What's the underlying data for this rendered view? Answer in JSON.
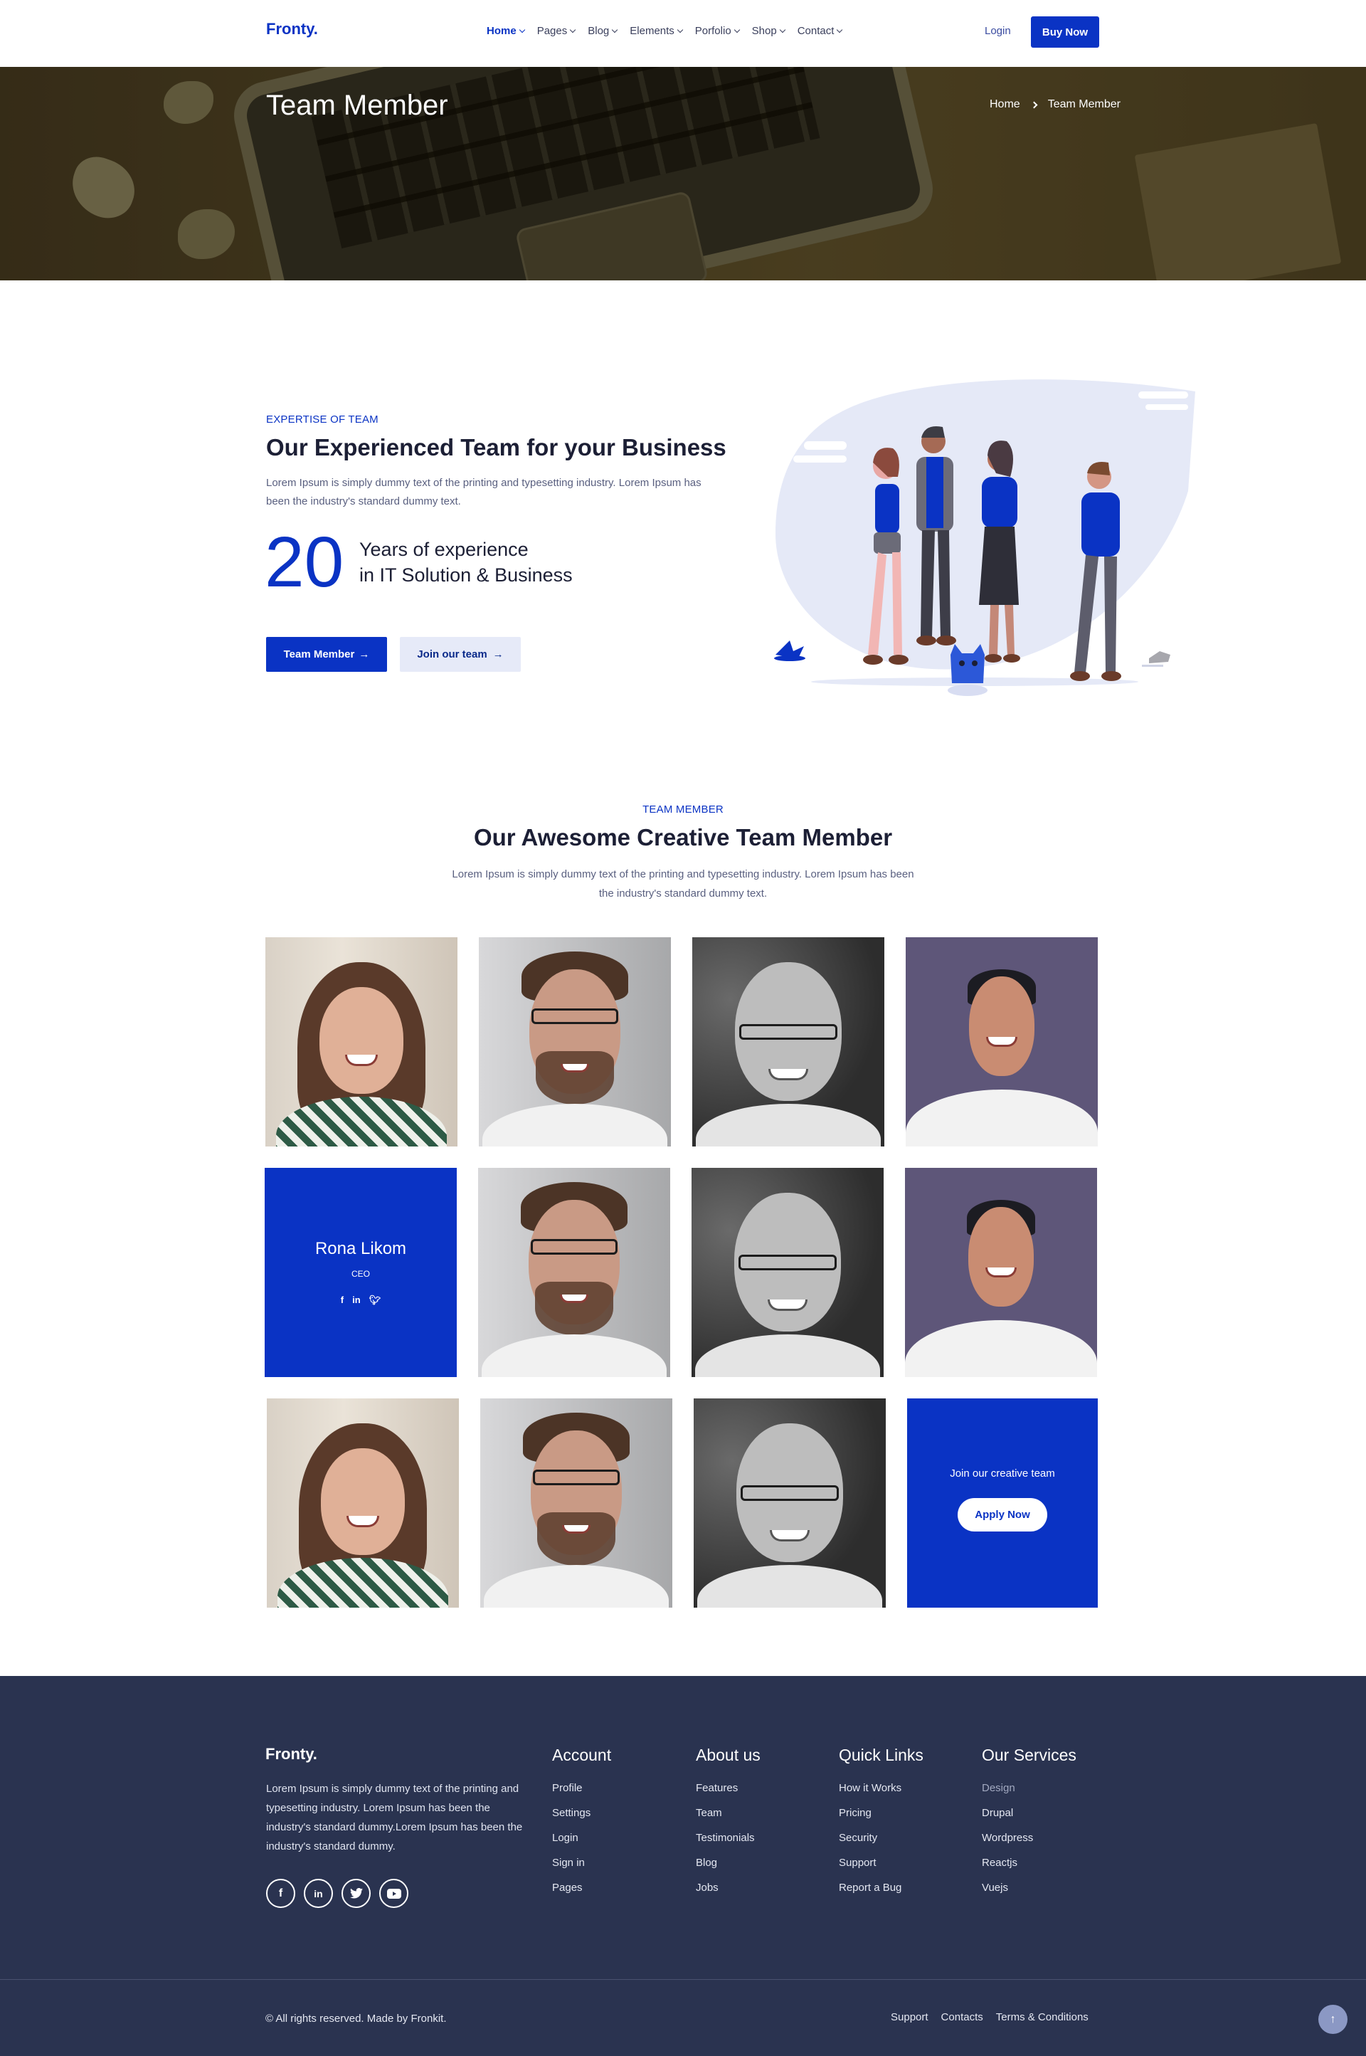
{
  "brand": {
    "logo": "Fronty.",
    "accent": "#0a33c4"
  },
  "nav": {
    "items": [
      {
        "label": "Home",
        "active": true
      },
      {
        "label": "Pages"
      },
      {
        "label": "Blog"
      },
      {
        "label": "Elements"
      },
      {
        "label": "Porfolio"
      },
      {
        "label": "Shop"
      },
      {
        "label": "Contact"
      }
    ],
    "login": "Login",
    "buy": "Buy Now"
  },
  "hero": {
    "title": "Team Member",
    "breadcrumb": [
      "Home",
      "Team Member"
    ]
  },
  "expertise": {
    "eyebrow": "EXPERTISE OF TEAM",
    "title": "Our Experienced Team for your Business",
    "desc": "Lorem Ipsum is simply dummy text of the printing and typesetting industry. Lorem Ipsum has been the industry's standard dummy text.",
    "years_number": "20",
    "years_line1": "Years of experience",
    "years_line2": "in IT Solution & Business",
    "btn_team": "Team Member",
    "btn_join": "Join our team"
  },
  "team": {
    "eyebrow": "TEAM MEMBER",
    "title": "Our Awesome Creative Team Member",
    "desc": "Lorem Ipsum is simply dummy text of the printing and typesetting industry. Lorem Ipsum has been the industry's standard dummy text.",
    "highlight": {
      "name": "Rona Likom",
      "role": "CEO",
      "social": [
        "f",
        "in",
        "t"
      ]
    },
    "join": {
      "text": "Join our creative team",
      "button": "Apply Now"
    }
  },
  "footer": {
    "logo": "Fronty.",
    "desc": "Lorem Ipsum is simply dummy text of the printing and typesetting industry. Lorem Ipsum has been the industry's standard dummy.Lorem Ipsum has been the industry's standard dummy.",
    "social": [
      "facebook-icon",
      "linkedin-icon",
      "twitter-icon",
      "youtube-icon"
    ],
    "columns": [
      {
        "title": "Account",
        "links": [
          "Profile",
          "Settings",
          "Login",
          "Sign in",
          "Pages"
        ]
      },
      {
        "title": "About us",
        "links": [
          "Features",
          "Team",
          "Testimonials",
          "Blog",
          "Jobs"
        ]
      },
      {
        "title": "Quick Links",
        "links": [
          "How it Works",
          "Pricing",
          "Security",
          "Support",
          "Report a Bug"
        ]
      },
      {
        "title": "Our Services",
        "links": [
          "Design",
          "Drupal",
          "Wordpress",
          "Reactjs",
          "Vuejs"
        ]
      }
    ],
    "copyright": "© All rights reserved. Made by Fronkit.",
    "bottom_links": [
      "Support",
      "Contacts",
      "Terms & Conditions"
    ]
  }
}
